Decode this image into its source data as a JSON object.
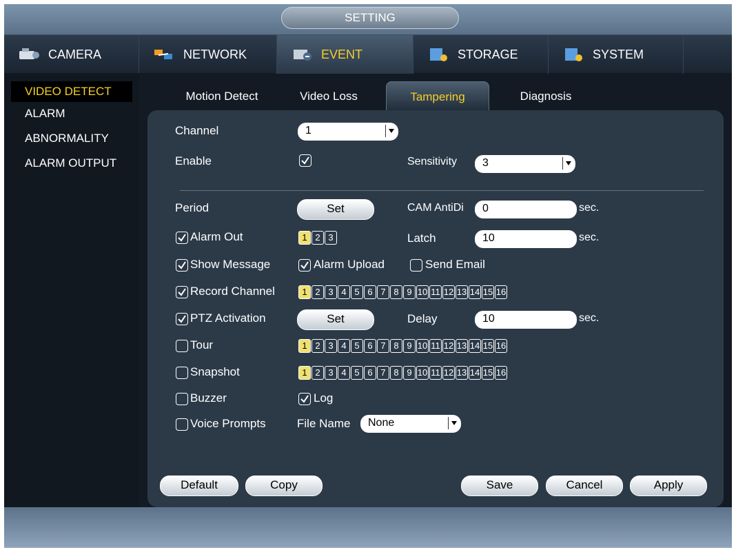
{
  "window_title": "SETTING",
  "nav": [
    {
      "label": "CAMERA",
      "icon": "camera-icon"
    },
    {
      "label": "NETWORK",
      "icon": "network-icon"
    },
    {
      "label": "EVENT",
      "icon": "event-icon"
    },
    {
      "label": "STORAGE",
      "icon": "storage-icon"
    },
    {
      "label": "SYSTEM",
      "icon": "system-icon"
    }
  ],
  "side_menu": [
    "VIDEO DETECT",
    "ALARM",
    "ABNORMALITY",
    "ALARM OUTPUT"
  ],
  "sub_tabs": [
    "Motion Detect",
    "Video Loss",
    "Tampering",
    "Diagnosis"
  ],
  "form": {
    "channel_label": "Channel",
    "channel_value": "1",
    "enable_label": "Enable",
    "sensitivity_label": "Sensitivity",
    "sensitivity_value": "3",
    "period_label": "Period",
    "set_label": "Set",
    "cam_antidither_label": "CAM AntiDi",
    "cam_antidither_value": "0",
    "sec": "sec.",
    "alarm_out_label": "Alarm Out",
    "latch_label": "Latch",
    "latch_value": "10",
    "show_message_label": "Show Message",
    "alarm_upload_label": "Alarm Upload",
    "send_email_label": "Send Email",
    "record_channel_label": "Record Channel",
    "ptz_activation_label": "PTZ Activation",
    "delay_label": "Delay",
    "delay_value": "10",
    "tour_label": "Tour",
    "snapshot_label": "Snapshot",
    "buzzer_label": "Buzzer",
    "log_label": "Log",
    "voice_prompts_label": "Voice Prompts",
    "file_name_label": "File Name",
    "file_name_value": "None"
  },
  "alarm_out_channels": [
    "1",
    "2",
    "3"
  ],
  "channels": [
    "1",
    "2",
    "3",
    "4",
    "5",
    "6",
    "7",
    "8",
    "9",
    "10",
    "11",
    "12",
    "13",
    "14",
    "15",
    "16"
  ],
  "buttons": {
    "default": "Default",
    "copy": "Copy",
    "save": "Save",
    "cancel": "Cancel",
    "apply": "Apply"
  },
  "colors": {
    "accent": "#f5cf2a",
    "panel": "#2c3a48"
  }
}
